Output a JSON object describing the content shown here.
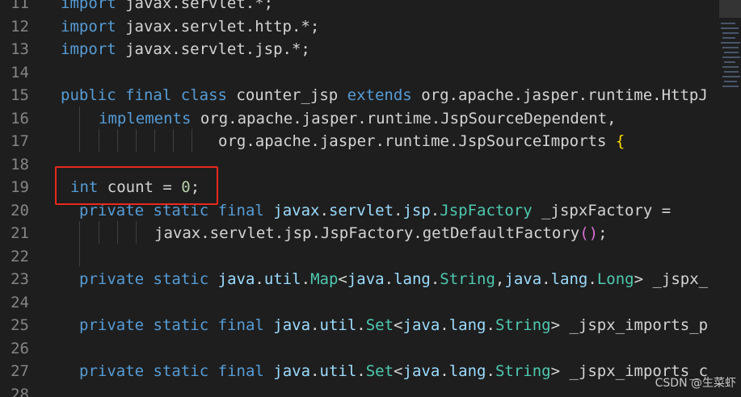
{
  "editor": {
    "lines": [
      {
        "num": "11",
        "segments": [
          {
            "t": "import",
            "c": "kw"
          },
          {
            "t": " javax.servlet.*;",
            "c": "txt"
          }
        ]
      },
      {
        "num": "12",
        "segments": [
          {
            "t": "import",
            "c": "kw"
          },
          {
            "t": " javax.servlet.http.*;",
            "c": "txt"
          }
        ]
      },
      {
        "num": "13",
        "segments": [
          {
            "t": "import",
            "c": "kw"
          },
          {
            "t": " javax.servlet.jsp.*;",
            "c": "txt"
          }
        ]
      },
      {
        "num": "14",
        "segments": []
      },
      {
        "num": "15",
        "segments": [
          {
            "t": "public",
            "c": "kw"
          },
          {
            "t": " ",
            "c": "txt"
          },
          {
            "t": "final",
            "c": "kw"
          },
          {
            "t": " ",
            "c": "txt"
          },
          {
            "t": "class",
            "c": "kw"
          },
          {
            "t": " counter_jsp ",
            "c": "txt"
          },
          {
            "t": "extends",
            "c": "kw"
          },
          {
            "t": " org.apache.jasper.runtime.HttpJ",
            "c": "txt"
          }
        ]
      },
      {
        "num": "16",
        "segments": [
          {
            "t": "implements",
            "c": "kw"
          },
          {
            "t": " org.apache.jasper.runtime.JspSourceDependent,",
            "c": "txt"
          }
        ]
      },
      {
        "num": "17",
        "segments": [
          {
            "t": "org.apache.jasper.runtime.JspSourceImports ",
            "c": "txt"
          },
          {
            "t": "{",
            "c": "brace"
          }
        ]
      },
      {
        "num": "18",
        "segments": []
      },
      {
        "num": "19",
        "segments": [
          {
            "t": "int",
            "c": "kw"
          },
          {
            "t": " count = ",
            "c": "txt"
          },
          {
            "t": "0",
            "c": "num"
          },
          {
            "t": ";",
            "c": "txt"
          }
        ]
      },
      {
        "num": "20",
        "segments": [
          {
            "t": "private",
            "c": "kw"
          },
          {
            "t": " ",
            "c": "txt"
          },
          {
            "t": "static",
            "c": "kw"
          },
          {
            "t": " ",
            "c": "txt"
          },
          {
            "t": "final",
            "c": "kw"
          },
          {
            "t": " ",
            "c": "txt"
          },
          {
            "t": "javax",
            "c": "pkg"
          },
          {
            "t": ".",
            "c": "txt"
          },
          {
            "t": "servlet",
            "c": "pkg"
          },
          {
            "t": ".",
            "c": "txt"
          },
          {
            "t": "jsp",
            "c": "pkg"
          },
          {
            "t": ".",
            "c": "txt"
          },
          {
            "t": "JspFactory",
            "c": "tp"
          },
          {
            "t": " _jspxFactory =",
            "c": "txt"
          }
        ]
      },
      {
        "num": "21",
        "segments": [
          {
            "t": "javax.servlet.jsp.JspFactory.getDefaultFactory",
            "c": "txt"
          },
          {
            "t": "()",
            "c": "paren"
          },
          {
            "t": ";",
            "c": "txt"
          }
        ]
      },
      {
        "num": "22",
        "segments": []
      },
      {
        "num": "23",
        "segments": [
          {
            "t": "private",
            "c": "kw"
          },
          {
            "t": " ",
            "c": "txt"
          },
          {
            "t": "static",
            "c": "kw"
          },
          {
            "t": " ",
            "c": "txt"
          },
          {
            "t": "java",
            "c": "pkg"
          },
          {
            "t": ".",
            "c": "txt"
          },
          {
            "t": "util",
            "c": "pkg"
          },
          {
            "t": ".",
            "c": "txt"
          },
          {
            "t": "Map",
            "c": "tp"
          },
          {
            "t": "<",
            "c": "txt"
          },
          {
            "t": "java",
            "c": "pkg"
          },
          {
            "t": ".",
            "c": "txt"
          },
          {
            "t": "lang",
            "c": "pkg"
          },
          {
            "t": ".",
            "c": "txt"
          },
          {
            "t": "String",
            "c": "tp"
          },
          {
            "t": ",",
            "c": "txt"
          },
          {
            "t": "java",
            "c": "pkg"
          },
          {
            "t": ".",
            "c": "txt"
          },
          {
            "t": "lang",
            "c": "pkg"
          },
          {
            "t": ".",
            "c": "txt"
          },
          {
            "t": "Long",
            "c": "tp"
          },
          {
            "t": "> _jspx_",
            "c": "txt"
          }
        ]
      },
      {
        "num": "24",
        "segments": []
      },
      {
        "num": "25",
        "segments": [
          {
            "t": "private",
            "c": "kw"
          },
          {
            "t": " ",
            "c": "txt"
          },
          {
            "t": "static",
            "c": "kw"
          },
          {
            "t": " ",
            "c": "txt"
          },
          {
            "t": "final",
            "c": "kw"
          },
          {
            "t": " ",
            "c": "txt"
          },
          {
            "t": "java",
            "c": "pkg"
          },
          {
            "t": ".",
            "c": "txt"
          },
          {
            "t": "util",
            "c": "pkg"
          },
          {
            "t": ".",
            "c": "txt"
          },
          {
            "t": "Set",
            "c": "tp"
          },
          {
            "t": "<",
            "c": "txt"
          },
          {
            "t": "java",
            "c": "pkg"
          },
          {
            "t": ".",
            "c": "txt"
          },
          {
            "t": "lang",
            "c": "pkg"
          },
          {
            "t": ".",
            "c": "txt"
          },
          {
            "t": "String",
            "c": "tp"
          },
          {
            "t": "> _jspx_imports_p",
            "c": "txt"
          }
        ]
      },
      {
        "num": "26",
        "segments": []
      },
      {
        "num": "27",
        "segments": [
          {
            "t": "private",
            "c": "kw"
          },
          {
            "t": " ",
            "c": "txt"
          },
          {
            "t": "static",
            "c": "kw"
          },
          {
            "t": " ",
            "c": "txt"
          },
          {
            "t": "final",
            "c": "kw"
          },
          {
            "t": " ",
            "c": "txt"
          },
          {
            "t": "java",
            "c": "pkg"
          },
          {
            "t": ".",
            "c": "txt"
          },
          {
            "t": "util",
            "c": "pkg"
          },
          {
            "t": ".",
            "c": "txt"
          },
          {
            "t": "Set",
            "c": "tp"
          },
          {
            "t": "<",
            "c": "txt"
          },
          {
            "t": "java",
            "c": "pkg"
          },
          {
            "t": ".",
            "c": "txt"
          },
          {
            "t": "lang",
            "c": "pkg"
          },
          {
            "t": ".",
            "c": "txt"
          },
          {
            "t": "String",
            "c": "tp"
          },
          {
            "t": "> _jspx_imports_c",
            "c": "txt"
          }
        ]
      },
      {
        "num": "28",
        "segments": []
      }
    ]
  },
  "watermark": "CSDN @生菜虾",
  "colors": {
    "background": "#1e1e1e",
    "keyword": "#569cd6",
    "type": "#4ec9b0",
    "package": "#9cdcfe",
    "number": "#b5cea8",
    "highlight_box": "#e8291c"
  }
}
